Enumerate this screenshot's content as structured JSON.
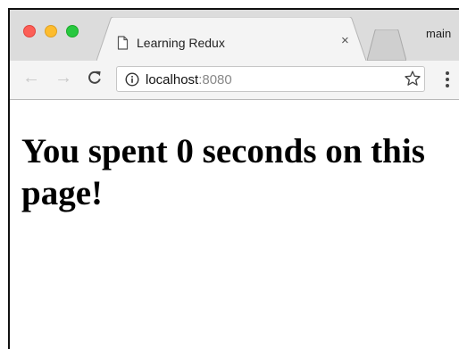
{
  "browser": {
    "tab": {
      "title": "Learning Redux",
      "close_label": "×",
      "icon": "page-icon"
    },
    "profile_label": "main",
    "address": {
      "host": "localhost",
      "port": ":8080"
    },
    "controls": {
      "back": "←",
      "forward": "→"
    },
    "colors": {
      "close": "#fc5f57",
      "minimize": "#fdbc2e",
      "zoom": "#28c840"
    }
  },
  "page": {
    "heading": "You spent 0 seconds on this page!"
  }
}
